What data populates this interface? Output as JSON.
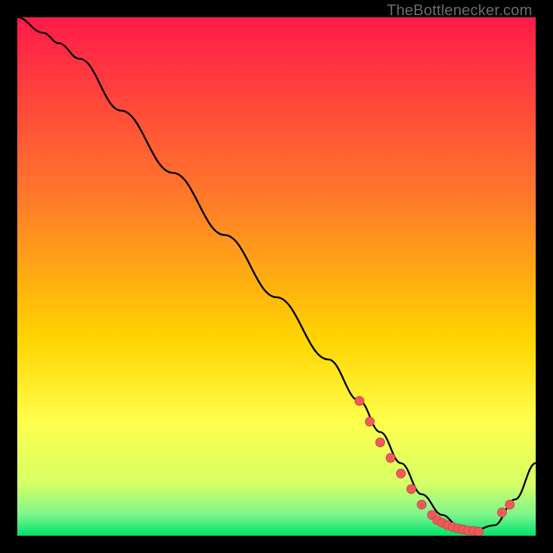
{
  "watermark": "TheBottlenecker.com",
  "colors": {
    "gradient_top": "#ff1a4a",
    "gradient_mid": "#ffd400",
    "gradient_green_top": "#d6ff66",
    "gradient_green": "#00e26a",
    "curve": "#000000",
    "marker": "#f05a5a",
    "marker_stroke": "#c94545"
  },
  "chart_data": {
    "type": "line",
    "title": "",
    "xlabel": "",
    "ylabel": "",
    "xlim": [
      0,
      100
    ],
    "ylim": [
      0,
      100
    ],
    "series": [
      {
        "name": "bottleneck-curve",
        "x": [
          0,
          5,
          8,
          12,
          20,
          30,
          40,
          50,
          60,
          66,
          70,
          74,
          78,
          82,
          85,
          88,
          92,
          96,
          100
        ],
        "y": [
          100,
          97,
          95,
          92,
          82,
          70,
          58,
          46,
          34,
          26,
          20,
          14,
          8,
          4,
          2,
          1,
          2,
          7,
          14
        ]
      }
    ],
    "markers": {
      "name": "highlighted-points",
      "x": [
        66,
        68,
        70,
        72,
        74,
        76,
        78,
        80,
        81,
        82,
        83,
        84,
        85,
        86,
        87,
        88,
        89,
        93.5,
        95
      ],
      "y": [
        26,
        22,
        18,
        15,
        12,
        9,
        6,
        4,
        3,
        2.5,
        2,
        1.7,
        1.4,
        1.2,
        1,
        0.9,
        0.8,
        4.5,
        6
      ]
    }
  }
}
